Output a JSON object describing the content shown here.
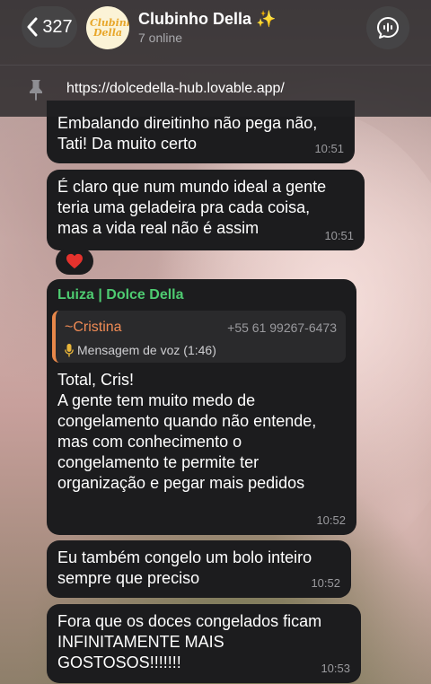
{
  "header": {
    "back_count": "327",
    "title": "Clubinho Della ✨",
    "subtitle": "7 online",
    "avatar_text": "Clubinho Della",
    "pinned_url": "https://dolcedella-hub.lovable.app/"
  },
  "icons": {
    "back": "chevron-left-icon",
    "call": "voice-chat-icon",
    "pin": "pin-icon",
    "mic": "microphone-icon",
    "reaction": "heart-icon"
  },
  "colors": {
    "bubble": "#1c1c1e",
    "sender_name": "#4ecb71",
    "reply_name": "#f08b55",
    "reply_bar": "#e8884a",
    "heart": "#e5322d"
  },
  "messages": [
    {
      "text": "Embalando direitinho não pega não,\nTati! Da muito certo",
      "time": "10:51"
    },
    {
      "text": "É claro que num mundo ideal a gente\nteria uma geladeira pra cada coisa,\nmas a vida real não é assim",
      "time": "10:51",
      "reaction": "❤️"
    },
    {
      "sender": "Luiza | Dolce Della",
      "reply": {
        "name": "~Cristina",
        "phone": "+55 61 99267-6473",
        "preview": "Mensagem de voz (1:46)"
      },
      "text": "Total, Cris!\nA gente tem muito medo de\ncongelamento quando não entende,\nmas com conhecimento o\ncongelamento te permite ter\norganização e pegar mais pedidos",
      "time": "10:52"
    },
    {
      "text": "Eu também congelo um bolo inteiro\nsempre que preciso",
      "time": "10:52"
    },
    {
      "text": "Fora que os doces congelados ficam\nINFINITAMENTE MAIS\nGOSTOSOS!!!!!!!",
      "time": "10:53"
    }
  ]
}
